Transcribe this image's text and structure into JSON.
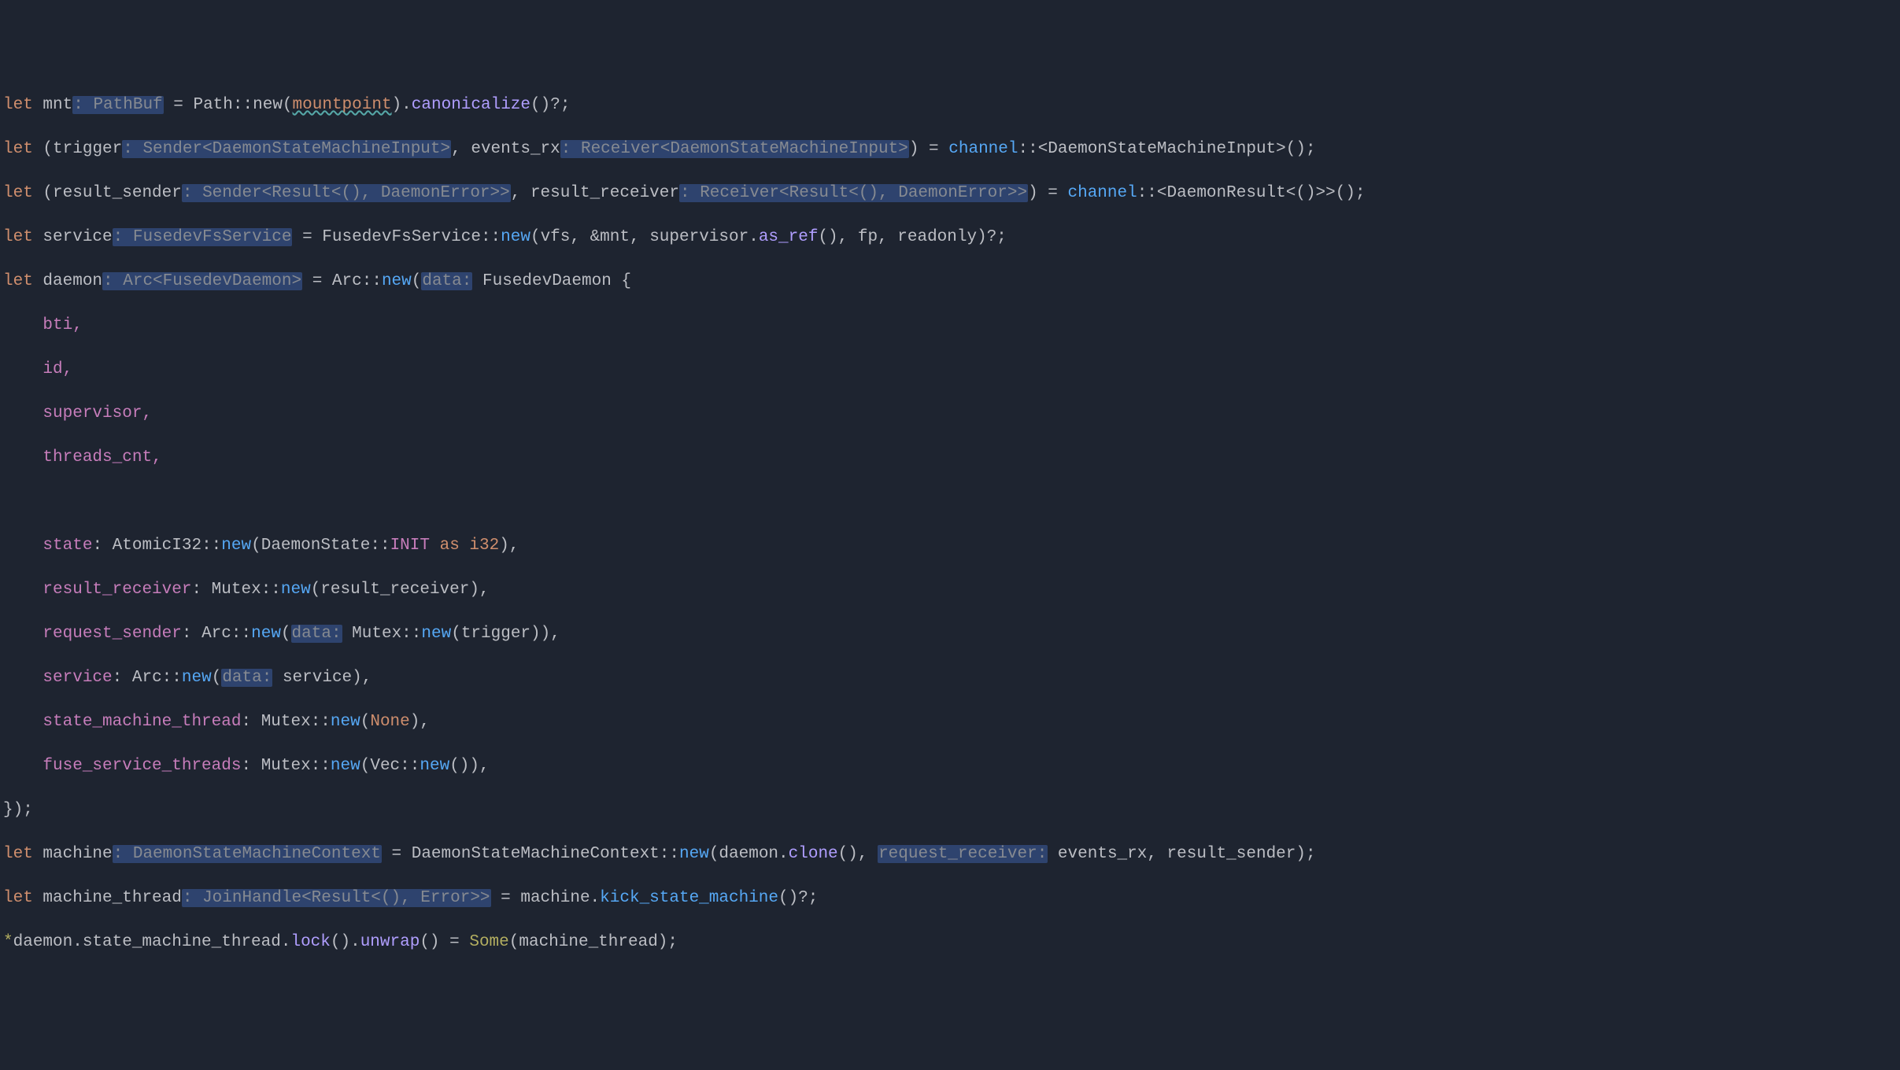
{
  "kw": {
    "let": "let",
    "as": "as"
  },
  "l1": {
    "mnt": "mnt",
    "hint_pathbuf": ": PathBuf",
    "eq": " = ",
    "path": "Path",
    "new": "new",
    "mountpoint": "mountpoint",
    "canon": "canonicalize",
    "tail": "()?;"
  },
  "l2": {
    "open": "(",
    "trigger": "trigger",
    "hint_trigger": ": Sender<DaemonStateMachineInput>",
    "comma": ", ",
    "events_rx": "events_rx",
    "hint_events": ": Receiver<DaemonStateMachineInput>",
    "close": ")",
    "eq": " = ",
    "channel": "channel",
    "turbofish": "::<",
    "dsmi": "DaemonStateMachineInput",
    "end": ">();"
  },
  "l3": {
    "result_sender": "result_sender",
    "hint_rs": ": Sender<Result<(), DaemonError>>",
    "result_receiver": "result_receiver",
    "hint_rr": ": Receiver<Result<(), DaemonError>>",
    "channel": "channel",
    "dr": "DaemonResult",
    "unit": "<()>",
    "end": ">();"
  },
  "l4": {
    "service": "service",
    "hint_service": ": FusedevFsService",
    "fsservice": "FusedevFsService",
    "new": "new",
    "args": "(vfs, &mnt, supervisor.",
    "as_ref": "as_ref",
    "args2": "(), fp, readonly)?;"
  },
  "l5": {
    "daemon": "daemon",
    "hint_daemon": ": Arc<FusedevDaemon>",
    "arc": "Arc",
    "new": "new",
    "data_hint": "data:",
    "fusedev": "FusedevDaemon",
    "brace": " {"
  },
  "l6": {
    "text": "bti,"
  },
  "l7": {
    "text": "id,"
  },
  "l8": {
    "text": "supervisor,"
  },
  "l9": {
    "text": "threads_cnt,"
  },
  "l11": {
    "state": "state",
    "atomic": "AtomicI32",
    "new": "new",
    "ds": "DaemonState",
    "init": "INIT",
    "i32": "i32",
    "end": "),"
  },
  "l12": {
    "rr": "result_receiver",
    "mutex": "Mutex",
    "new": "new",
    "arg": "result_receiver",
    "end": "),"
  },
  "l13": {
    "rs": "request_sender",
    "arc": "Arc",
    "new": "new",
    "data_hint": "data:",
    "mutex": "Mutex",
    "new2": "new",
    "trigger": "trigger",
    "end": ")),"
  },
  "l14": {
    "service": "service",
    "arc": "Arc",
    "new": "new",
    "data_hint": "data:",
    "svc": "service",
    "end": "),"
  },
  "l15": {
    "smt": "state_machine_thread",
    "mutex": "Mutex",
    "new": "new",
    "none": "None",
    "end": "),"
  },
  "l16": {
    "fst": "fuse_service_threads",
    "mutex": "Mutex",
    "new": "new",
    "vec": "Vec",
    "new2": "new",
    "end": "()),"
  },
  "l17": {
    "text": "});"
  },
  "l18": {
    "machine": "machine",
    "hint_machine": ": DaemonStateMachineContext",
    "ctx": "DaemonStateMachineContext",
    "new": "new",
    "args1": "(daemon.",
    "clone": "clone",
    "args2": "(), ",
    "hint_rr": "request_receiver:",
    "events_rx": " events_rx, result_sender);"
  },
  "l19": {
    "mt": "machine_thread",
    "hint_mt": ": JoinHandle<Result<(), Error>>",
    "eq": " = machine.",
    "kick": "kick_state_machine",
    "end": "()?;"
  },
  "l20": {
    "star": "*",
    "pre": "daemon.state_machine_thread.",
    "lock": "lock",
    "mid": "().",
    "unwrap": "unwrap",
    "post": "() = ",
    "some": "Some",
    "arg": "(machine_thread);"
  }
}
